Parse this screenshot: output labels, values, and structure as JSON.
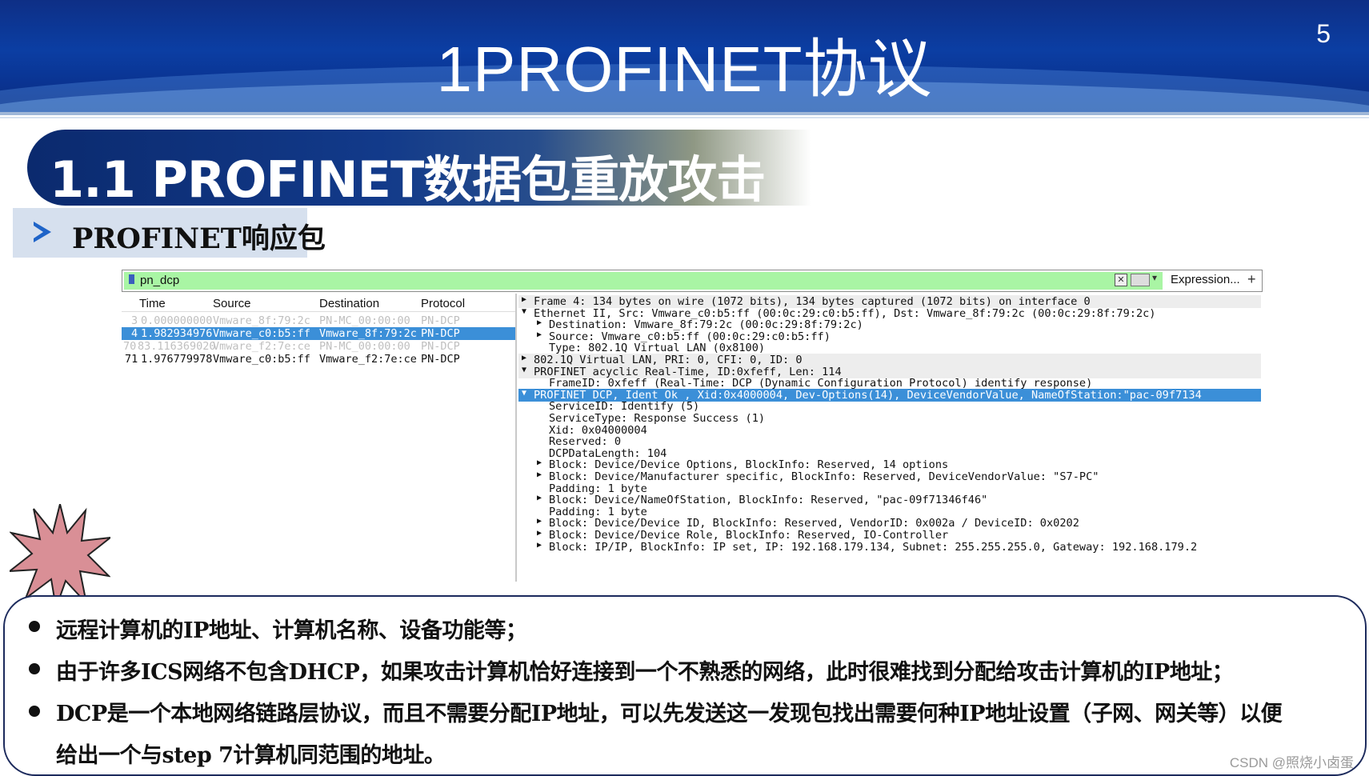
{
  "slide": {
    "title": "1PROFINET协议",
    "page_number": "5",
    "section_heading": "1.1   PROFINET数据包重放攻击",
    "subheading": "PROFINET响应包"
  },
  "wireshark": {
    "filter_value": "pn_dcp",
    "expression_label": "Expression...",
    "plus_label": "+",
    "columns": {
      "time": "Time",
      "source": "Source",
      "destination": "Destination",
      "protocol": "Protocol"
    },
    "packets": [
      {
        "no": "3",
        "time": "0.000000000",
        "source": "Vmware_8f:79:2c",
        "destination": "PN-MC_00:00:00",
        "protocol": "PN-DCP"
      },
      {
        "no": "4",
        "time": "1.982934976",
        "source": "Vmware_c0:b5:ff",
        "destination": "Vmware_8f:79:2c",
        "protocol": "PN-DCP"
      },
      {
        "no": "70",
        "time": "83.116369020",
        "source": "Vmware_f2:7e:ce",
        "destination": "PN-MC_00:00:00",
        "protocol": "PN-DCP"
      },
      {
        "no": "71",
        "time": "1.976779978",
        "source": "Vmware_c0:b5:ff",
        "destination": "Vmware_f2:7e:ce",
        "protocol": "PN-DCP"
      }
    ],
    "details": [
      {
        "text": "Frame 4: 134 bytes on wire (1072 bits), 134 bytes captured (1072 bits) on interface 0",
        "expander": "▶"
      },
      {
        "text": "Ethernet II, Src: Vmware_c0:b5:ff (00:0c:29:c0:b5:ff), Dst: Vmware_8f:79:2c (00:0c:29:8f:79:2c)",
        "expander": "▼"
      },
      {
        "text": "Destination: Vmware_8f:79:2c (00:0c:29:8f:79:2c)",
        "expander": "▶"
      },
      {
        "text": "Source: Vmware_c0:b5:ff (00:0c:29:c0:b5:ff)",
        "expander": "▶"
      },
      {
        "text": "Type: 802.1Q Virtual LAN (0x8100)",
        "expander": ""
      },
      {
        "text": "802.1Q Virtual LAN, PRI: 0, CFI: 0, ID: 0",
        "expander": "▶"
      },
      {
        "text": "PROFINET acyclic Real-Time, ID:0xfeff, Len: 114",
        "expander": "▼"
      },
      {
        "text": "FrameID: 0xfeff (Real-Time: DCP (Dynamic Configuration Protocol) identify response)",
        "expander": ""
      },
      {
        "text": "PROFINET DCP, Ident Ok , Xid:0x4000004, Dev-Options(14), DeviceVendorValue, NameOfStation:\"pac-09f7134",
        "expander": "▼"
      },
      {
        "text": "ServiceID: Identify (5)",
        "expander": ""
      },
      {
        "text": "ServiceType: Response Success (1)",
        "expander": ""
      },
      {
        "text": "Xid: 0x04000004",
        "expander": ""
      },
      {
        "text": "Reserved: 0",
        "expander": ""
      },
      {
        "text": "DCPDataLength: 104",
        "expander": ""
      },
      {
        "text": "Block: Device/Device Options, BlockInfo: Reserved, 14 options",
        "expander": "▶"
      },
      {
        "text": "Block: Device/Manufacturer specific, BlockInfo: Reserved, DeviceVendorValue: \"S7-PC\"",
        "expander": "▶"
      },
      {
        "text": "Padding: 1 byte",
        "expander": ""
      },
      {
        "text": "Block: Device/NameOfStation, BlockInfo: Reserved, \"pac-09f71346f46\"",
        "expander": "▶"
      },
      {
        "text": "Padding: 1 byte",
        "expander": ""
      },
      {
        "text": "Block: Device/Device ID, BlockInfo: Reserved, VendorID: 0x002a / DeviceID: 0x0202",
        "expander": "▶"
      },
      {
        "text": "Block: Device/Device Role, BlockInfo: Reserved, IO-Controller",
        "expander": "▶"
      },
      {
        "text": "Block: IP/IP, BlockInfo: IP set, IP: 192.168.179.134, Subnet: 255.255.255.0, Gateway: 192.168.179.2",
        "expander": "▶"
      }
    ]
  },
  "bullets": [
    "远程计算机的IP地址、计算机名称、设备功能等；",
    "由于许多ICS网络不包含DHCP，如果攻击计算机恰好连接到一个不熟悉的网络，此时很难找到分配给攻击计算机的IP地址；",
    "DCP是一个本地网络链路层协议，而且不需要分配IP地址，可以先发送这一发现包找出需要何种IP地址设置（子网、网关等）以便",
    "给出一个与step 7计算机同范围的地址。"
  ],
  "watermark": "CSDN @照烧小卤蛋",
  "colors": {
    "banner": "#0b3ea3",
    "selection": "#3b8fd8",
    "filter_bg": "#a9f5a4",
    "burst": "#d98f96"
  }
}
